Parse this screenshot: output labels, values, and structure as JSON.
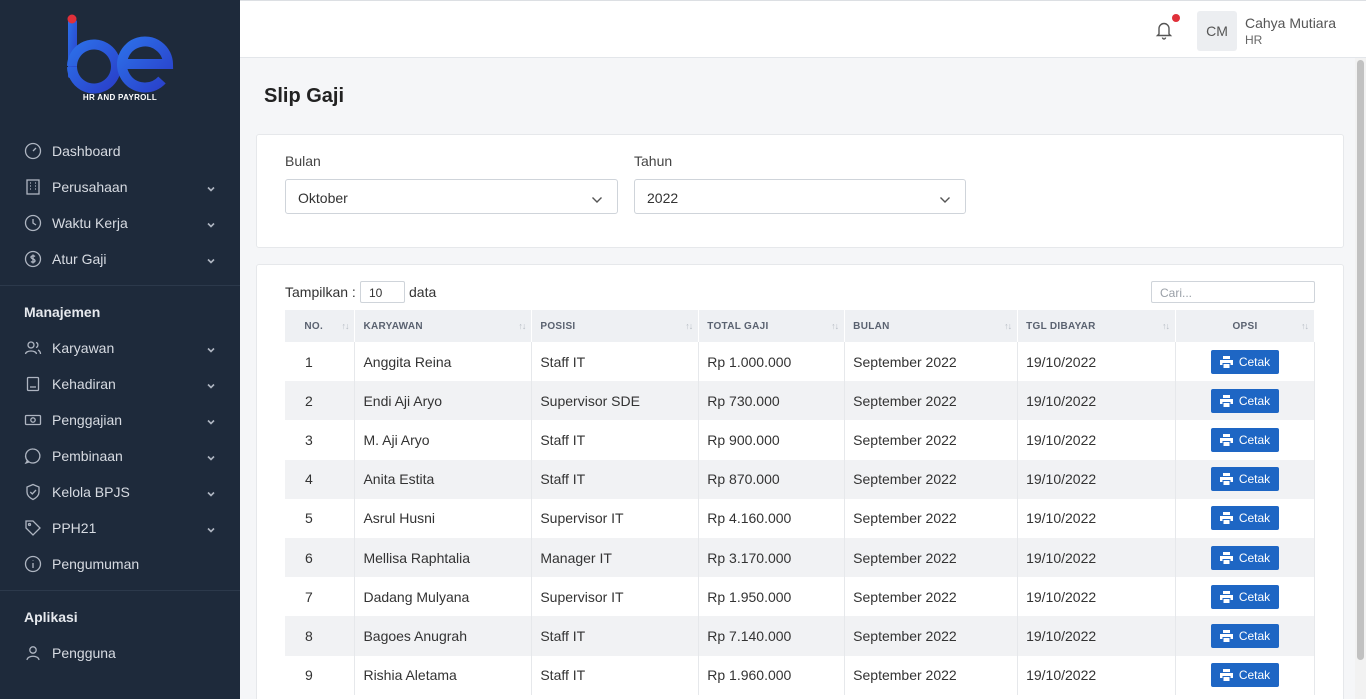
{
  "brand": {
    "logo_text": "be",
    "subtitle": "HR AND PAYROLL"
  },
  "sidebar": {
    "items": [
      {
        "label": "Dashboard",
        "icon": "gauge-icon",
        "expandable": false
      },
      {
        "label": "Perusahaan",
        "icon": "building-icon",
        "expandable": true
      },
      {
        "label": "Waktu Kerja",
        "icon": "clock-icon",
        "expandable": true
      },
      {
        "label": "Atur Gaji",
        "icon": "dollar-circle-icon",
        "expandable": true
      }
    ],
    "section_manajemen": "Manajemen",
    "manajemen": [
      {
        "label": "Karyawan",
        "icon": "users-icon",
        "expandable": true
      },
      {
        "label": "Kehadiran",
        "icon": "clipboard-icon",
        "expandable": true
      },
      {
        "label": "Penggajian",
        "icon": "money-icon",
        "expandable": true
      },
      {
        "label": "Pembinaan",
        "icon": "message-circle-icon",
        "expandable": true
      },
      {
        "label": "Kelola BPJS",
        "icon": "shield-check-icon",
        "expandable": true
      },
      {
        "label": "PPH21",
        "icon": "tag-icon",
        "expandable": true
      },
      {
        "label": "Pengumuman",
        "icon": "info-icon",
        "expandable": false
      }
    ],
    "section_aplikasi": "Aplikasi",
    "aplikasi": [
      {
        "label": "Pengguna",
        "icon": "user-icon",
        "expandable": false
      }
    ]
  },
  "header": {
    "user_initials": "CM",
    "user_name": "Cahya Mutiara",
    "user_role": "HR",
    "notification_dot_color": "#e0303a"
  },
  "page": {
    "title": "Slip Gaji"
  },
  "filters": {
    "bulan_label": "Bulan",
    "bulan_value": "Oktober",
    "tahun_label": "Tahun",
    "tahun_value": "2022"
  },
  "table": {
    "show_prefix": "Tampilkan :",
    "page_length": "10",
    "show_suffix": "data",
    "search_placeholder": "Cari...",
    "columns": [
      "NO.",
      "KARYAWAN",
      "POSISI",
      "TOTAL GAJI",
      "BULAN",
      "TGL DIBAYAR",
      "OPSI"
    ],
    "action_label": "Cetak",
    "rows": [
      {
        "no": "1",
        "karyawan": "Anggita Reina",
        "posisi": "Staff IT",
        "total": "Rp 1.000.000",
        "bulan": "September 2022",
        "tgl": "19/10/2022"
      },
      {
        "no": "2",
        "karyawan": "Endi Aji Aryo",
        "posisi": "Supervisor SDE",
        "total": "Rp 730.000",
        "bulan": "September 2022",
        "tgl": "19/10/2022"
      },
      {
        "no": "3",
        "karyawan": "M. Aji Aryo",
        "posisi": "Staff IT",
        "total": "Rp 900.000",
        "bulan": "September 2022",
        "tgl": "19/10/2022"
      },
      {
        "no": "4",
        "karyawan": "Anita Estita",
        "posisi": "Staff IT",
        "total": "Rp 870.000",
        "bulan": "September 2022",
        "tgl": "19/10/2022"
      },
      {
        "no": "5",
        "karyawan": "Asrul Husni",
        "posisi": "Supervisor IT",
        "total": "Rp 4.160.000",
        "bulan": "September 2022",
        "tgl": "19/10/2022"
      },
      {
        "no": "6",
        "karyawan": "Mellisa Raphtalia",
        "posisi": "Manager IT",
        "total": "Rp 3.170.000",
        "bulan": "September 2022",
        "tgl": "19/10/2022"
      },
      {
        "no": "7",
        "karyawan": "Dadang Mulyana",
        "posisi": "Supervisor IT",
        "total": "Rp 1.950.000",
        "bulan": "September 2022",
        "tgl": "19/10/2022"
      },
      {
        "no": "8",
        "karyawan": "Bagoes Anugrah",
        "posisi": "Staff IT",
        "total": "Rp 7.140.000",
        "bulan": "September 2022",
        "tgl": "19/10/2022"
      },
      {
        "no": "9",
        "karyawan": "Rishia Aletama",
        "posisi": "Staff IT",
        "total": "Rp 1.960.000",
        "bulan": "September 2022",
        "tgl": "19/10/2022"
      }
    ]
  },
  "colors": {
    "sidebar_bg": "#1e2a3b",
    "accent": "#1e66c4",
    "logo_red": "#e0303a",
    "logo_blue": "#2e5fe0"
  }
}
